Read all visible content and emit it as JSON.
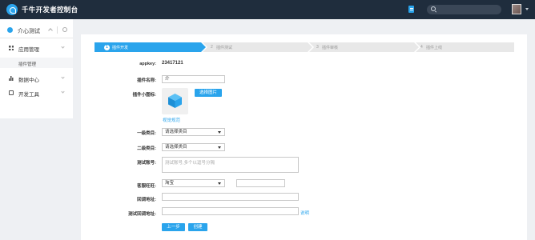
{
  "header": {
    "app_title": "千牛开发者控制台"
  },
  "sidebar": {
    "project_name": "介心测试",
    "items": [
      {
        "label": "应用管理"
      },
      {
        "label": "数据中心"
      },
      {
        "label": "开发工具"
      }
    ],
    "sub_item": "插件管理"
  },
  "steps": [
    {
      "num": "1",
      "label": "插件开发"
    },
    {
      "num": "2",
      "label": "插件测试"
    },
    {
      "num": "3",
      "label": "插件审核"
    },
    {
      "num": "4",
      "label": "插件上线"
    }
  ],
  "form": {
    "appkey_label": "appkey:",
    "appkey_value": "23417121",
    "name_label": "插件名称:",
    "name_value": "介",
    "icon_label": "插件小图标:",
    "choose_image": "选择图片",
    "view_spec": "视觉规范",
    "cat1_label": "一级类目:",
    "cat1_value": "请选择类目",
    "cat2_label": "二级类目:",
    "cat2_value": "请选择类目",
    "test_account_label": "测试账号:",
    "test_account_placeholder": "测试账号,多个以逗号分隔",
    "customer_service_label": "客服旺旺:",
    "customer_service_value": "淘宝",
    "callback_label": "回调地址:",
    "test_callback_label": "测试回调地址:",
    "help_link": "说明",
    "prev_button": "上一步",
    "create_button": "创建"
  },
  "colors": {
    "accent": "#2aa4ec",
    "topbar": "#1f2d3d"
  }
}
